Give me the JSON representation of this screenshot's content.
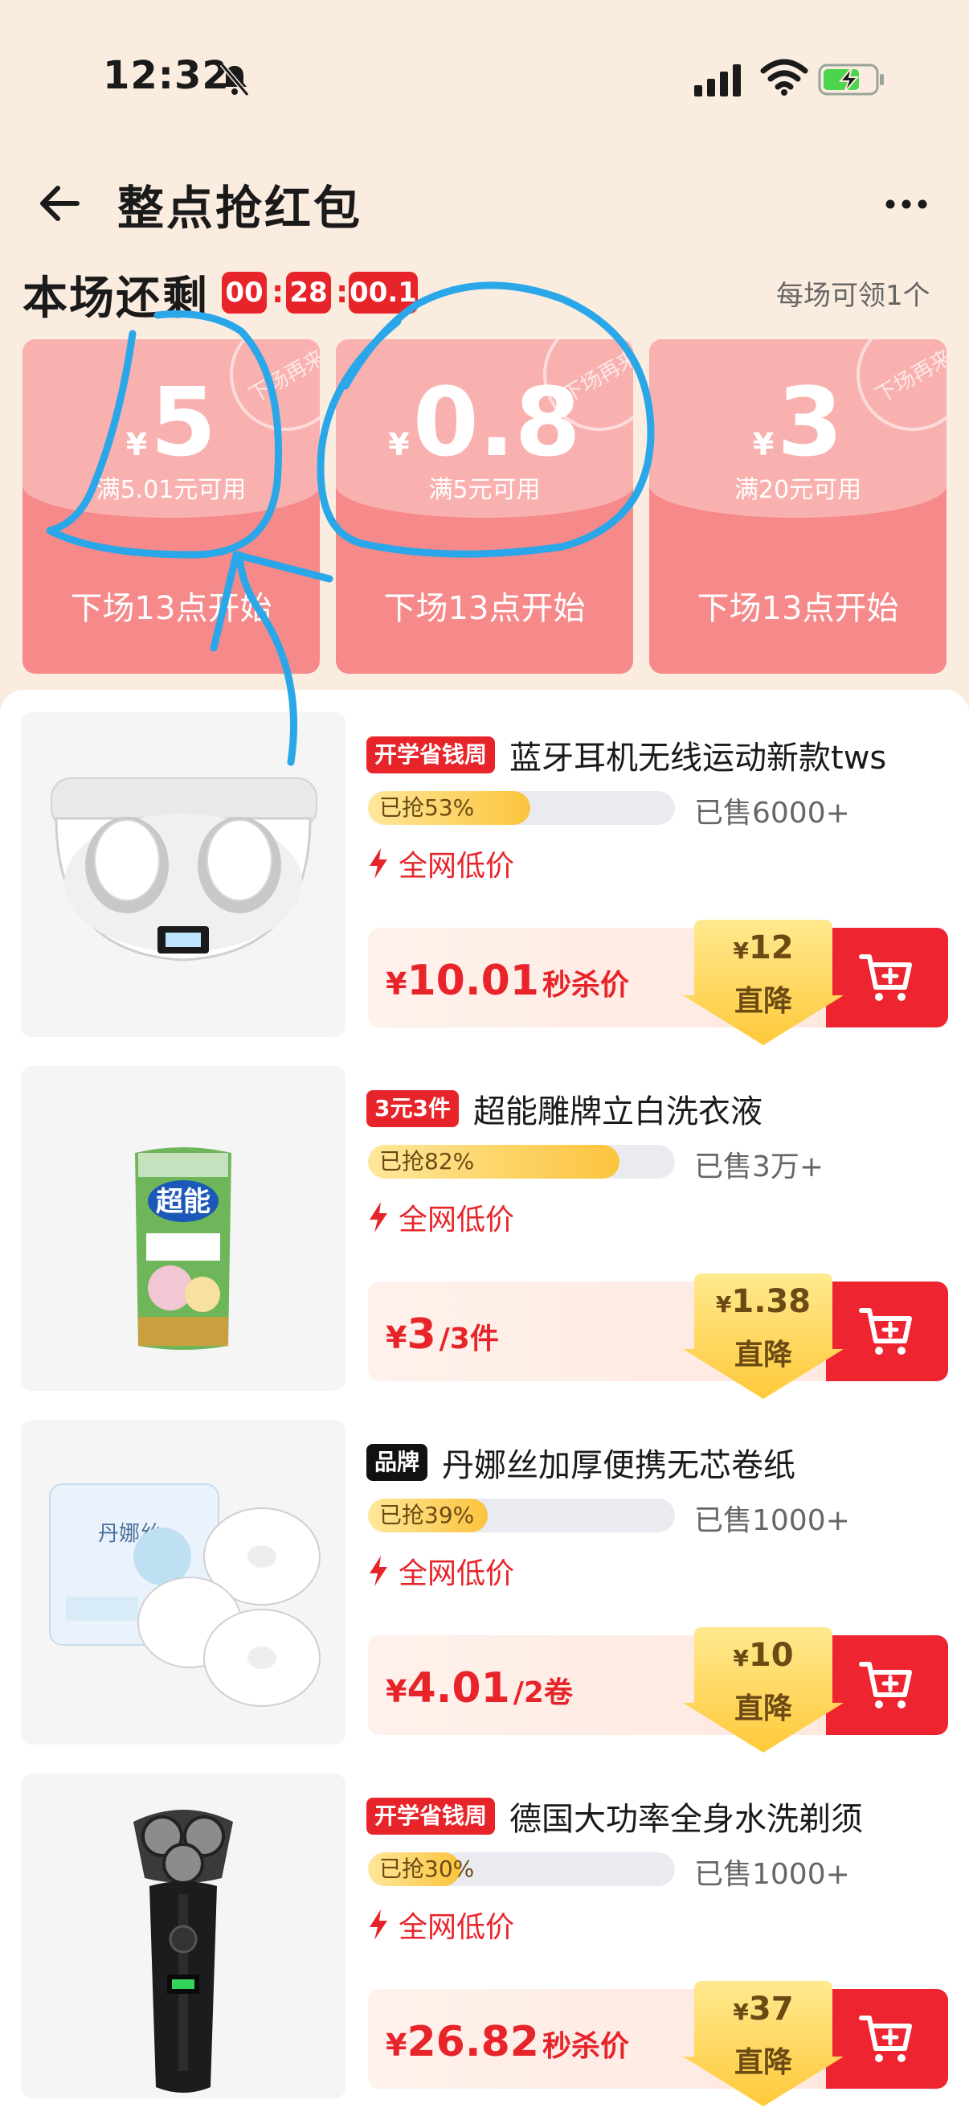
{
  "status_bar": {
    "time": "12:32"
  },
  "header": {
    "title": "整点抢红包"
  },
  "session": {
    "remaining_label": "本场还剩",
    "countdown": {
      "hours": "00",
      "minutes": "28",
      "seconds": "00.1"
    },
    "per_session_note": "每场可领1个"
  },
  "coupons": [
    {
      "currency": "¥",
      "amount": "5",
      "condition": "满5.01元可用",
      "next_session": "下场13点开始",
      "stamp": "下场再来"
    },
    {
      "currency": "¥",
      "amount": "0.8",
      "condition": "满5元可用",
      "next_session": "下场13点开始",
      "stamp": "下场再来"
    },
    {
      "currency": "¥",
      "amount": "3",
      "condition": "满20元可用",
      "next_session": "下场13点开始",
      "stamp": "下场再来"
    }
  ],
  "products": [
    {
      "tag": "开学省钱周",
      "tag_style": "red",
      "name": "蓝牙耳机无线运动新款tws",
      "grabbed_label": "已抢53%",
      "grabbed_fraction": 0.53,
      "sold": "已售6000+",
      "lowest_price_label": "全网低价",
      "price_currency": "¥",
      "price": "10.01",
      "price_suffix": "秒杀价",
      "drop_currency": "¥",
      "drop_amount": "12",
      "drop_label": "直降",
      "image": "earbuds-case"
    },
    {
      "tag": "3元3件",
      "tag_style": "red",
      "name": "超能雕牌立白洗衣液",
      "grabbed_label": "已抢82%",
      "grabbed_fraction": 0.82,
      "sold": "已售3万+",
      "lowest_price_label": "全网低价",
      "price_currency": "¥",
      "price": "3",
      "price_suffix": "/3件",
      "drop_currency": "¥",
      "drop_amount": "1.38",
      "drop_label": "直降",
      "image": "detergent-pouch",
      "image_brand": "超能"
    },
    {
      "tag": "品牌",
      "tag_style": "black",
      "name": "丹娜丝加厚便携无芯卷纸",
      "grabbed_label": "已抢39%",
      "grabbed_fraction": 0.39,
      "sold": "已售1000+",
      "lowest_price_label": "全网低价",
      "price_currency": "¥",
      "price": "4.01",
      "price_suffix": "/2卷",
      "drop_currency": "¥",
      "drop_amount": "10",
      "drop_label": "直降",
      "image": "toilet-paper-rolls",
      "image_brand": "丹娜丝"
    },
    {
      "tag": "开学省钱周",
      "tag_style": "red",
      "name": "德国大功率全身水洗剃须",
      "grabbed_label": "已抢30%",
      "grabbed_fraction": 0.3,
      "sold": "已售1000+",
      "lowest_price_label": "全网低价",
      "price_currency": "¥",
      "price": "26.82",
      "price_suffix": "秒杀价",
      "drop_currency": "¥",
      "drop_amount": "37",
      "drop_label": "直降",
      "image": "electric-shaver"
    }
  ],
  "colors": {
    "accent_red": "#e8242b",
    "page_bg": "#fbece0",
    "coupon": "#f6898a",
    "progress_fill": "#fbc43d",
    "annotation": "#2aa7e8"
  },
  "icons": [
    "bell-muted-icon",
    "signal-icon",
    "wifi-icon",
    "battery-charging-icon",
    "back-arrow-icon",
    "more-dots-icon",
    "lightning-icon",
    "cart-add-icon"
  ]
}
